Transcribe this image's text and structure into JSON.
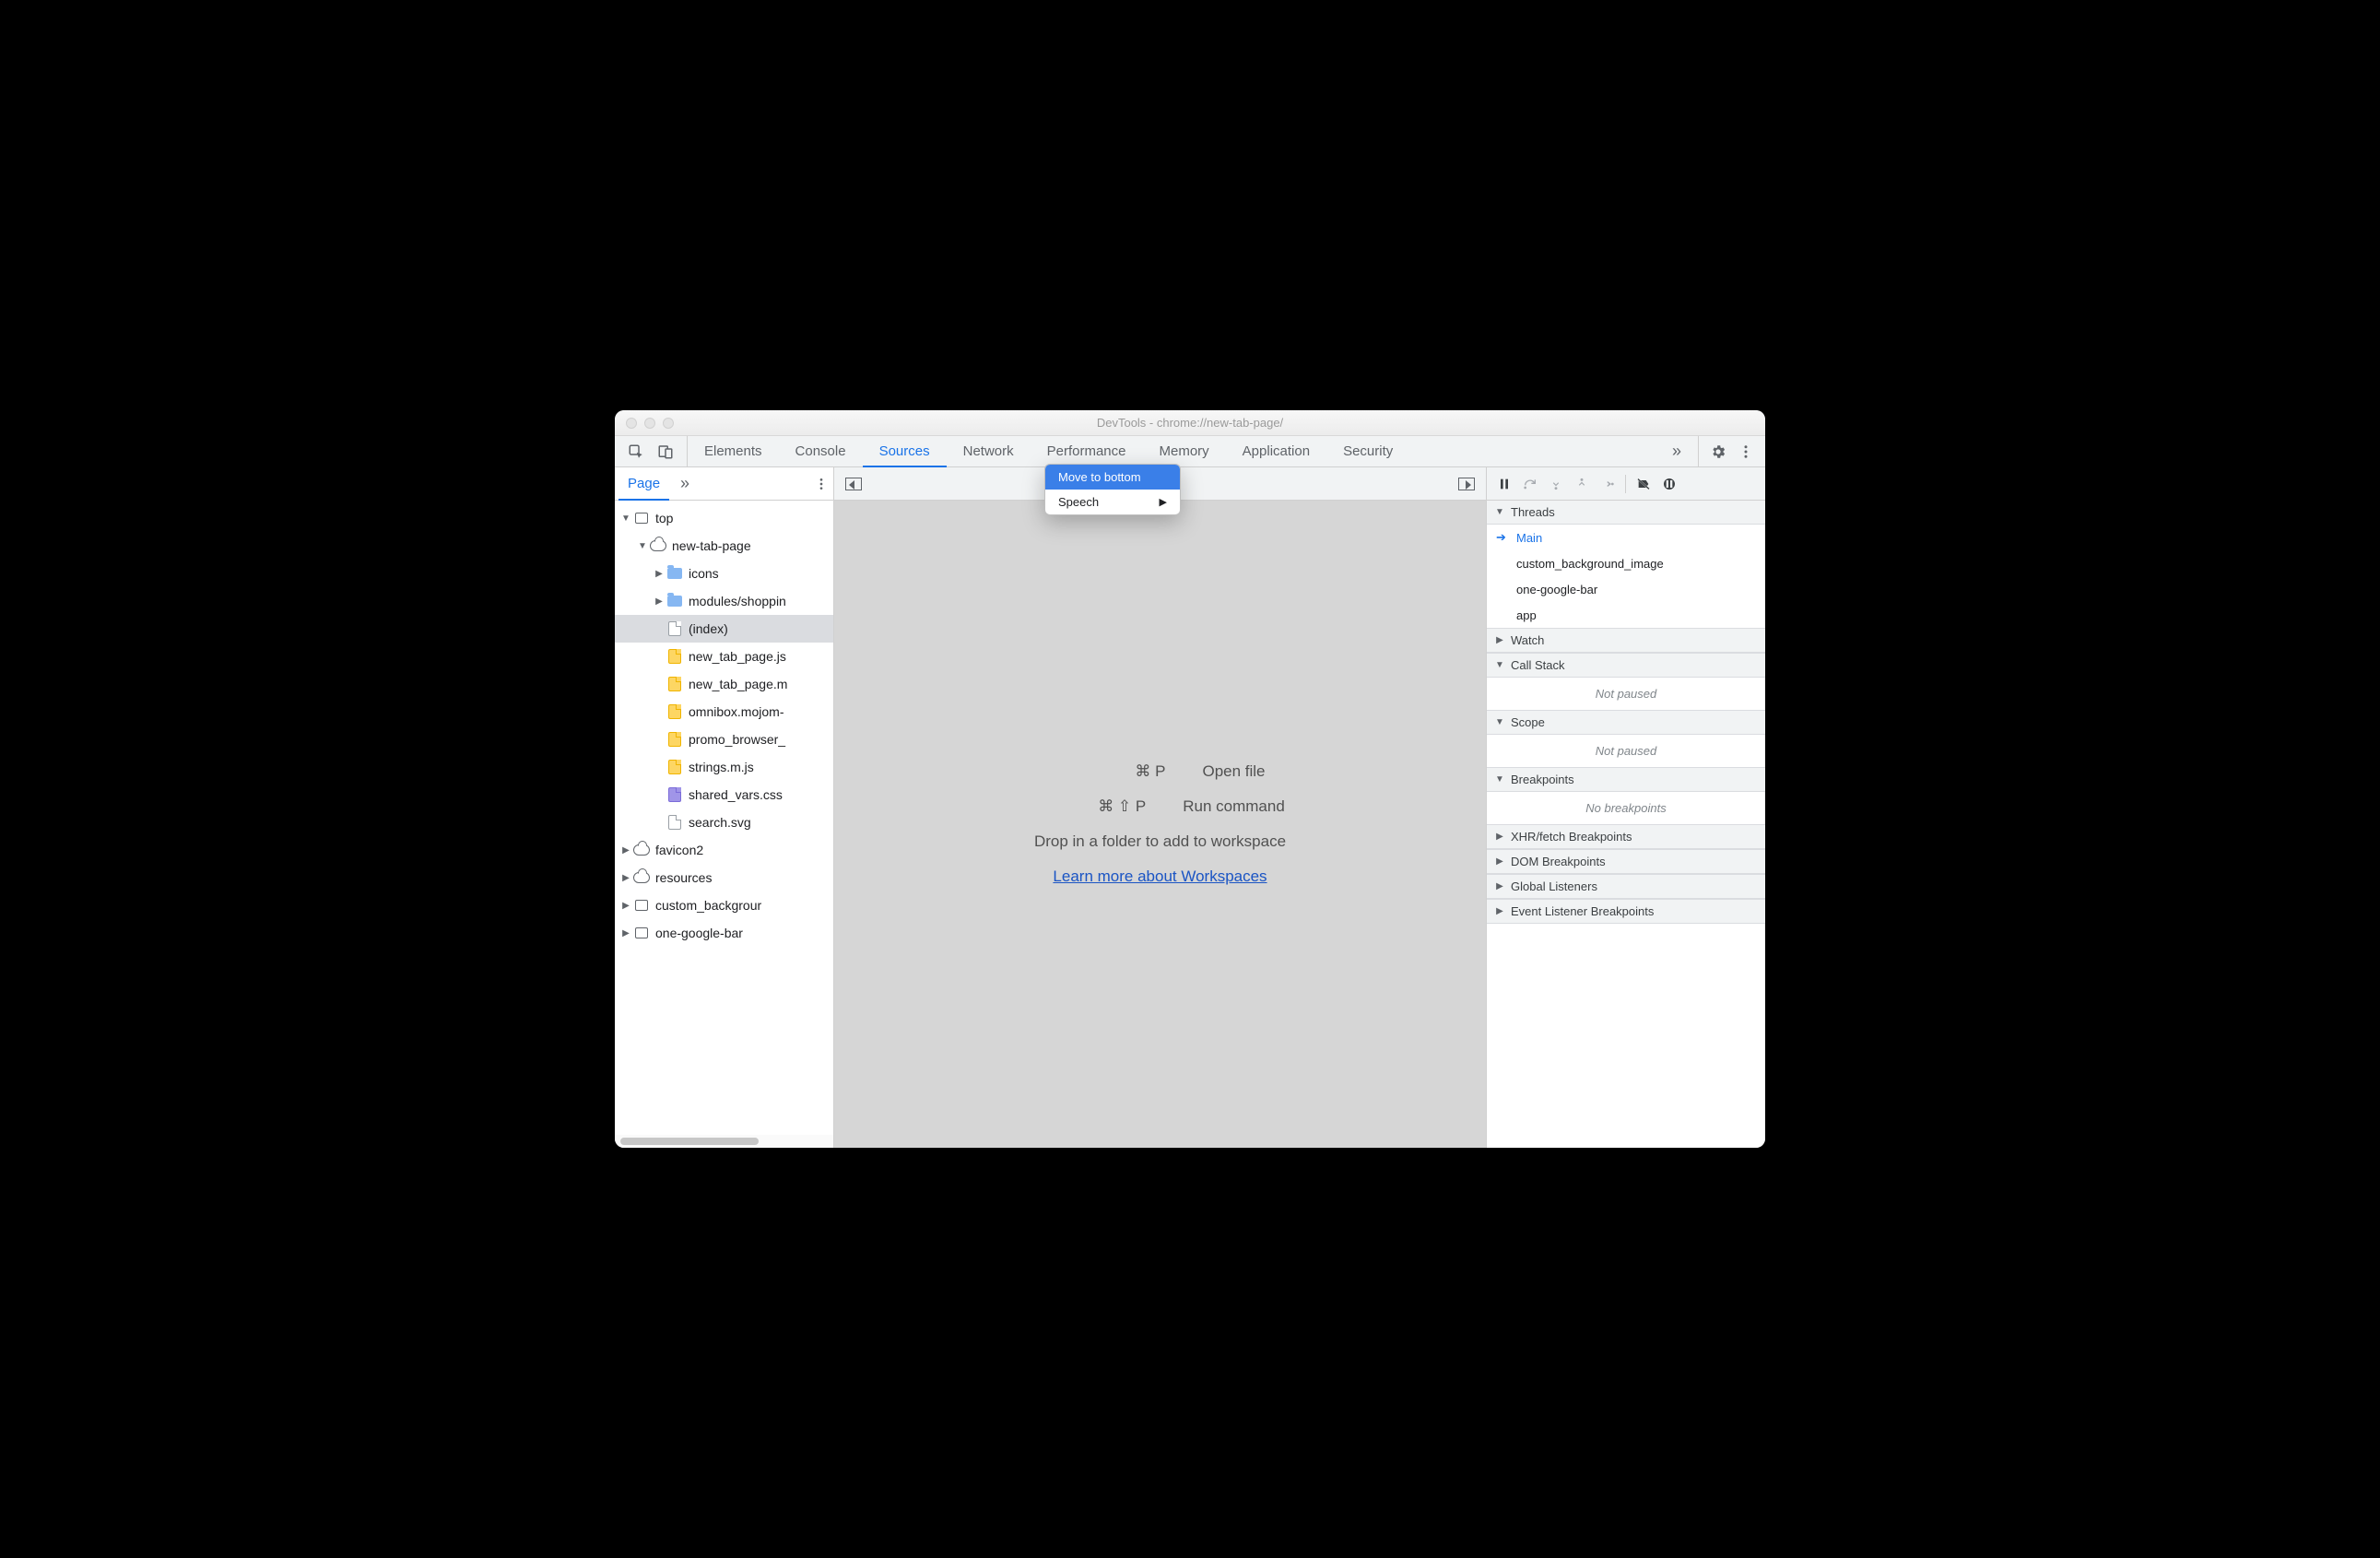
{
  "window": {
    "title": "DevTools - chrome://new-tab-page/"
  },
  "toptabs": {
    "items": [
      "Elements",
      "Console",
      "Sources",
      "Network",
      "Performance",
      "Memory",
      "Application",
      "Security"
    ],
    "activeIndex": 2,
    "moreGlyph": "»"
  },
  "context_menu": {
    "items": [
      {
        "label": "Move to bottom",
        "selected": true,
        "submenu": false
      },
      {
        "label": "Speech",
        "selected": false,
        "submenu": true
      }
    ]
  },
  "left": {
    "tab": "Page",
    "moreGlyph": "»",
    "tree": [
      {
        "depth": 0,
        "arrow": "down",
        "icon": "frame",
        "label": "top"
      },
      {
        "depth": 1,
        "arrow": "down",
        "icon": "cloud",
        "label": "new-tab-page"
      },
      {
        "depth": 2,
        "arrow": "right",
        "icon": "folder",
        "label": "icons"
      },
      {
        "depth": 2,
        "arrow": "right",
        "icon": "folder",
        "label": "modules/shoppin"
      },
      {
        "depth": 2,
        "arrow": "",
        "icon": "doc",
        "label": "(index)",
        "selected": true
      },
      {
        "depth": 2,
        "arrow": "",
        "icon": "js",
        "label": "new_tab_page.js"
      },
      {
        "depth": 2,
        "arrow": "",
        "icon": "js",
        "label": "new_tab_page.m"
      },
      {
        "depth": 2,
        "arrow": "",
        "icon": "js",
        "label": "omnibox.mojom-"
      },
      {
        "depth": 2,
        "arrow": "",
        "icon": "js",
        "label": "promo_browser_"
      },
      {
        "depth": 2,
        "arrow": "",
        "icon": "js",
        "label": "strings.m.js"
      },
      {
        "depth": 2,
        "arrow": "",
        "icon": "css",
        "label": "shared_vars.css"
      },
      {
        "depth": 2,
        "arrow": "",
        "icon": "doc",
        "label": "search.svg"
      },
      {
        "depth": 0,
        "arrow": "right",
        "icon": "cloud",
        "label": "favicon2"
      },
      {
        "depth": 0,
        "arrow": "right",
        "icon": "cloud",
        "label": "resources"
      },
      {
        "depth": 0,
        "arrow": "right",
        "icon": "frame",
        "label": "custom_backgrour"
      },
      {
        "depth": 0,
        "arrow": "right",
        "icon": "frame",
        "label": "one-google-bar"
      }
    ]
  },
  "center": {
    "openfile_keys": "⌘ P",
    "openfile_label": "Open file",
    "runcmd_keys": "⌘ ⇧ P",
    "runcmd_label": "Run command",
    "drop_text": "Drop in a folder to add to workspace",
    "learn_link": "Learn more about Workspaces"
  },
  "right": {
    "sections": {
      "threads": {
        "title": "Threads",
        "expanded": true,
        "items": [
          {
            "label": "Main",
            "current": true
          },
          {
            "label": "custom_background_image",
            "current": false
          },
          {
            "label": "one-google-bar",
            "current": false
          },
          {
            "label": "app",
            "current": false
          }
        ]
      },
      "watch": {
        "title": "Watch",
        "expanded": false
      },
      "callstack": {
        "title": "Call Stack",
        "expanded": true,
        "placeholder": "Not paused"
      },
      "scope": {
        "title": "Scope",
        "expanded": true,
        "placeholder": "Not paused"
      },
      "breakpoints": {
        "title": "Breakpoints",
        "expanded": true,
        "placeholder": "No breakpoints"
      },
      "xhr": {
        "title": "XHR/fetch Breakpoints",
        "expanded": false
      },
      "dom": {
        "title": "DOM Breakpoints",
        "expanded": false
      },
      "global": {
        "title": "Global Listeners",
        "expanded": false
      },
      "evl": {
        "title": "Event Listener Breakpoints",
        "expanded": false
      }
    }
  }
}
